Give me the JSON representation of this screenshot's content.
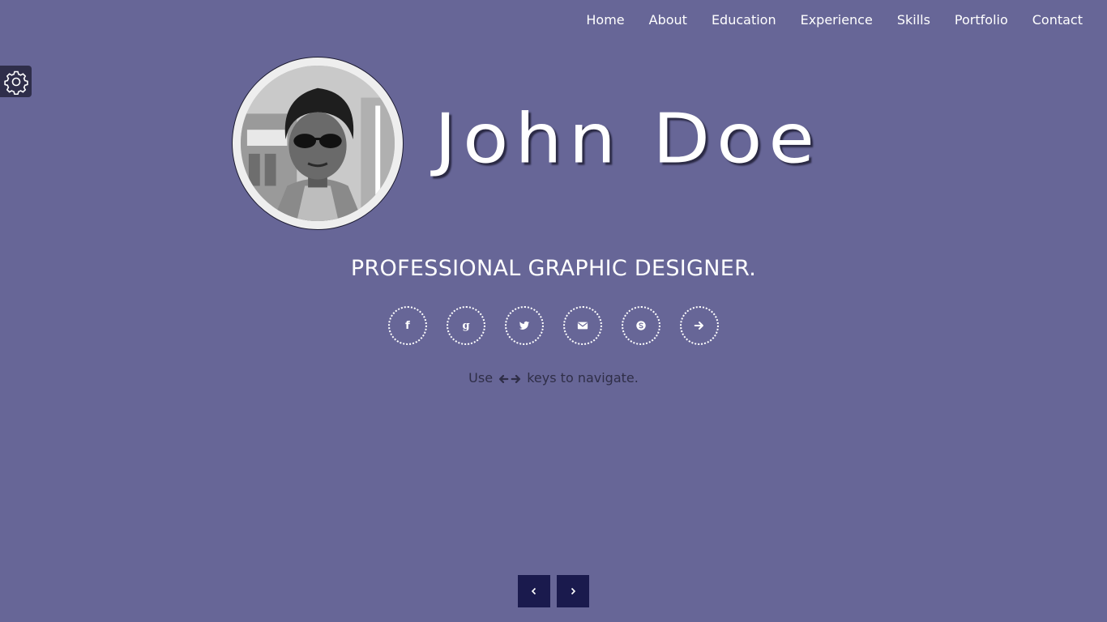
{
  "nav": {
    "items": [
      {
        "label": "Home"
      },
      {
        "label": "About"
      },
      {
        "label": "Education"
      },
      {
        "label": "Experience"
      },
      {
        "label": "Skills"
      },
      {
        "label": "Portfolio"
      },
      {
        "label": "Contact"
      }
    ]
  },
  "settings": {
    "icon": "gear-icon"
  },
  "hero": {
    "name": "John Doe",
    "subtitle": "PROFESSIONAL GRAPHIC DESIGNER."
  },
  "socials": [
    {
      "icon": "facebook-icon",
      "glyph": "f"
    },
    {
      "icon": "google-plus-icon",
      "glyph": "g"
    },
    {
      "icon": "twitter-icon"
    },
    {
      "icon": "envelope-icon"
    },
    {
      "icon": "skype-icon"
    },
    {
      "icon": "arrow-right-icon"
    }
  ],
  "hint": {
    "prefix": "Use",
    "suffix": "keys to navigate."
  },
  "pager": {
    "prev_icon": "chevron-left-icon",
    "next_icon": "chevron-right-icon"
  },
  "colors": {
    "background": "#676697",
    "pager_button": "#1a1a4d",
    "settings_bg": "#2f2e4a",
    "hint_text": "#2f2e47"
  }
}
